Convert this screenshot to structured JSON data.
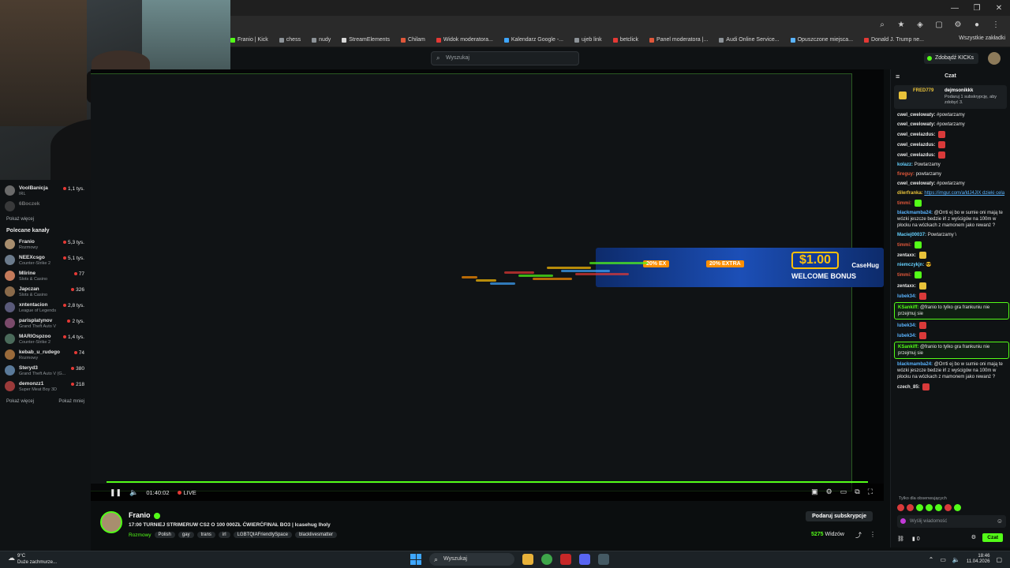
{
  "window": {
    "controls": [
      "—",
      "❐",
      "✕"
    ]
  },
  "bookmarks": {
    "items": [
      "Franio | Kick",
      "chess",
      "nudy",
      "StreamElements",
      "Chilam",
      "Widok moderatora...",
      "Kalendarz Google -...",
      "ujeb link",
      "betclick",
      "Panel moderatora |...",
      "Audi Online Service...",
      "Opuszczone miejsca...",
      "Donald J. Trump ne..."
    ],
    "right": "Wszystkie zakładki"
  },
  "header": {
    "search_placeholder": "Wyszukaj",
    "kicks_button": "Zdobądź KICKs"
  },
  "sidebar": {
    "top_channels": [
      {
        "name": "VoolBanicja",
        "cat": "IRL",
        "viewers": "1,1 tys.",
        "online": true
      },
      {
        "name": "6Boczek",
        "cat": "",
        "viewers": "",
        "online": false
      }
    ],
    "show_more_1": "Pokaż więcej",
    "section_title": "Polecane kanały",
    "recommended": [
      {
        "name": "Franio",
        "cat": "Rozmowy",
        "viewers": "5,3 tys.",
        "color": "#a88e6e"
      },
      {
        "name": "NEEXcsgo",
        "cat": "Counter-Strike 2",
        "viewers": "5,1 tys.",
        "color": "#6b7b8c"
      },
      {
        "name": "Mlirine",
        "cat": "Slots & Casino",
        "viewers": "77",
        "color": "#c47a5a"
      },
      {
        "name": "Japczan",
        "cat": "Slots & Casino",
        "viewers": "326",
        "color": "#8a6a4a"
      },
      {
        "name": "xntentacion",
        "cat": "League of Legends",
        "viewers": "2,8 tys.",
        "color": "#5a5a7a"
      },
      {
        "name": "parisplatynov",
        "cat": "Grand Theft Auto V",
        "viewers": "2 tys.",
        "color": "#7a4a6a"
      },
      {
        "name": "MARIOspzoo",
        "cat": "Counter-Strike 2",
        "viewers": "1,4 tys.",
        "color": "#4a6a5a"
      },
      {
        "name": "kebab_u_rudego",
        "cat": "Rozmowy",
        "viewers": "74",
        "color": "#9a6a3a"
      },
      {
        "name": "Steryd3",
        "cat": "Grand Theft Auto V (G...",
        "viewers": "380",
        "color": "#5a7a9a"
      },
      {
        "name": "demonzz1",
        "cat": "Super Meat Boy 3D",
        "viewers": "218",
        "color": "#9a3a3a"
      }
    ],
    "show_more_2": "Pokaż więcej",
    "show_less": "Pokaż mniej"
  },
  "player": {
    "time": "01:40:02",
    "live": "LIVE",
    "ad": {
      "amount": "$1.00",
      "bonus": "WELCOME BONUS",
      "brand": "CaseHug",
      "promo1": "20% EXTRA",
      "promo2": "20% EX"
    }
  },
  "stream": {
    "streamer": "Franio",
    "title": "17:00 TURNIEJ STRIMERUW CS2 O 100 000ZŁ ĆWIERĆFINAŁ BO3 | lcasehug lholy",
    "category": "Rozmowy",
    "tags": [
      "Polish",
      "gay",
      "trans",
      "irl",
      "LGBTQIAFriendlySpace",
      "blacklivesmatter"
    ],
    "subscribe": "Podaruj subskrypcje",
    "viewers_count": "5275",
    "viewers_label": "Widzów"
  },
  "chat": {
    "title": "Czat",
    "pinned": {
      "user": "FRED779",
      "name": "dejmsonikkk",
      "text": "Podaruj 1 subskrypcję, aby zdobyć 3."
    },
    "messages": [
      {
        "user": "cwel_cwelowaty:",
        "text": "#powtarzamy",
        "ucolor": "#e6e6e6",
        "hl": false
      },
      {
        "user": "cwel_cwelowaty:",
        "text": "#powtarzamy",
        "ucolor": "#e6e6e6",
        "hl": false
      },
      {
        "user": "cwel_cwelazdus:",
        "text": "",
        "ucolor": "#e6e6e6",
        "hl": false,
        "emote": "#d93a3a"
      },
      {
        "user": "cwel_cwelazdus:",
        "text": "",
        "ucolor": "#e6e6e6",
        "hl": false,
        "emote": "#d93a3a"
      },
      {
        "user": "cwel_cwelazdus:",
        "text": "",
        "ucolor": "#e6e6e6",
        "hl": false,
        "emote": "#d93a3a"
      },
      {
        "user": "kolazz:",
        "text": "Powtarzamy",
        "ucolor": "#66d1ff",
        "hl": false
      },
      {
        "user": "fireguy:",
        "text": "powtarzamy",
        "ucolor": "#e0573a",
        "hl": false
      },
      {
        "user": "cwel_cwelowaty:",
        "text": "#powtarzamy",
        "ucolor": "#e6e6e6",
        "hl": false
      },
      {
        "user": "dilerfranka:",
        "text": "https://imgur.com/a/ldJ4JIX dzieki cela",
        "ucolor": "#e8c23a",
        "hl": false,
        "link": true
      },
      {
        "user": "timmi:",
        "text": "",
        "ucolor": "#e0573a",
        "hl": false,
        "emote": "#53fc18"
      },
      {
        "user": "blackmamba24:",
        "text": "@Orrti ej bo w sumie oni mają te wózki jeszcze bedzie irl z wyścigów na 100m w płocku na wózkach z mamonem jako rewanż ?",
        "ucolor": "#5ab4ff",
        "hl": false
      },
      {
        "user": "Maciej00037:",
        "text": "Powtarzamy \\",
        "ucolor": "#66d1ff",
        "hl": false
      },
      {
        "user": "timmi:",
        "text": "",
        "ucolor": "#e0573a",
        "hl": false,
        "emote": "#53fc18"
      },
      {
        "user": "zentaxx:",
        "text": "",
        "ucolor": "#e6e6e6",
        "hl": false,
        "emote": "#e8c23a"
      },
      {
        "user": "niemczykjn:",
        "text": "😎",
        "ucolor": "#66d1ff",
        "hl": false
      },
      {
        "user": "timmi:",
        "text": "",
        "ucolor": "#e0573a",
        "hl": false,
        "emote": "#53fc18"
      },
      {
        "user": "zentaxx:",
        "text": "",
        "ucolor": "#e6e6e6",
        "hl": false,
        "emote": "#e8c23a"
      },
      {
        "user": "lubek34:",
        "text": "",
        "ucolor": "#5ab4ff",
        "hl": false,
        "emote": "#d93a3a"
      },
      {
        "user": "KSankiff:",
        "text": "@franio to tylko gra frankuniu nie przejmuj sie",
        "ucolor": "#53fc18",
        "hl": true
      },
      {
        "user": "lubek34:",
        "text": "",
        "ucolor": "#5ab4ff",
        "hl": false,
        "emote": "#d93a3a"
      },
      {
        "user": "lubek34:",
        "text": "",
        "ucolor": "#5ab4ff",
        "hl": false,
        "emote": "#d93a3a"
      },
      {
        "user": "KSankiff:",
        "text": "@franio to tylko gra frankuniu nie przejmuj sie",
        "ucolor": "#53fc18",
        "hl": true
      },
      {
        "user": "blackmamba24:",
        "text": "@Orrti ej bo w sumie oni mają te wózki jeszcze bedzie irl z wyścigów na 100m w płocku na wózkach z mamonem jako rewanż ?",
        "ucolor": "#5ab4ff",
        "hl": false
      },
      {
        "user": "czech_85:",
        "text": "",
        "ucolor": "#e6e6e6",
        "hl": false,
        "emote": "#d93a3a"
      }
    ],
    "sub_only": "Tylko dla obsenwujących",
    "input_placeholder": "Wyślij wiadomość",
    "points": "0",
    "send_button": "Czat"
  },
  "taskbar": {
    "weather_temp": "9°C",
    "weather_desc": "Duże zachmurze...",
    "search": "Wyszukaj",
    "time": "18:46",
    "date": "11.04.2026"
  }
}
